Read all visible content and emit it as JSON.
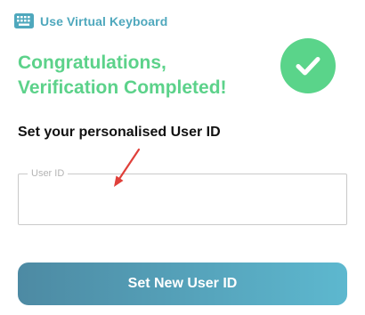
{
  "virtual_keyboard": {
    "label": "Use Virtual Keyboard",
    "icon": "keyboard-icon"
  },
  "success": {
    "title_line1": "Congratulations,",
    "title_line2": "Verification Completed!",
    "icon": "checkmark-icon"
  },
  "form": {
    "heading": "Set your personalised User ID",
    "user_id": {
      "legend": "User ID",
      "value": ""
    },
    "submit_label": "Set New User ID"
  },
  "colors": {
    "accent": "#4fa8bd",
    "success": "#5ad48a",
    "button_start": "#4d8aa3",
    "button_end": "#5db8cf",
    "arrow": "#e0403a"
  }
}
